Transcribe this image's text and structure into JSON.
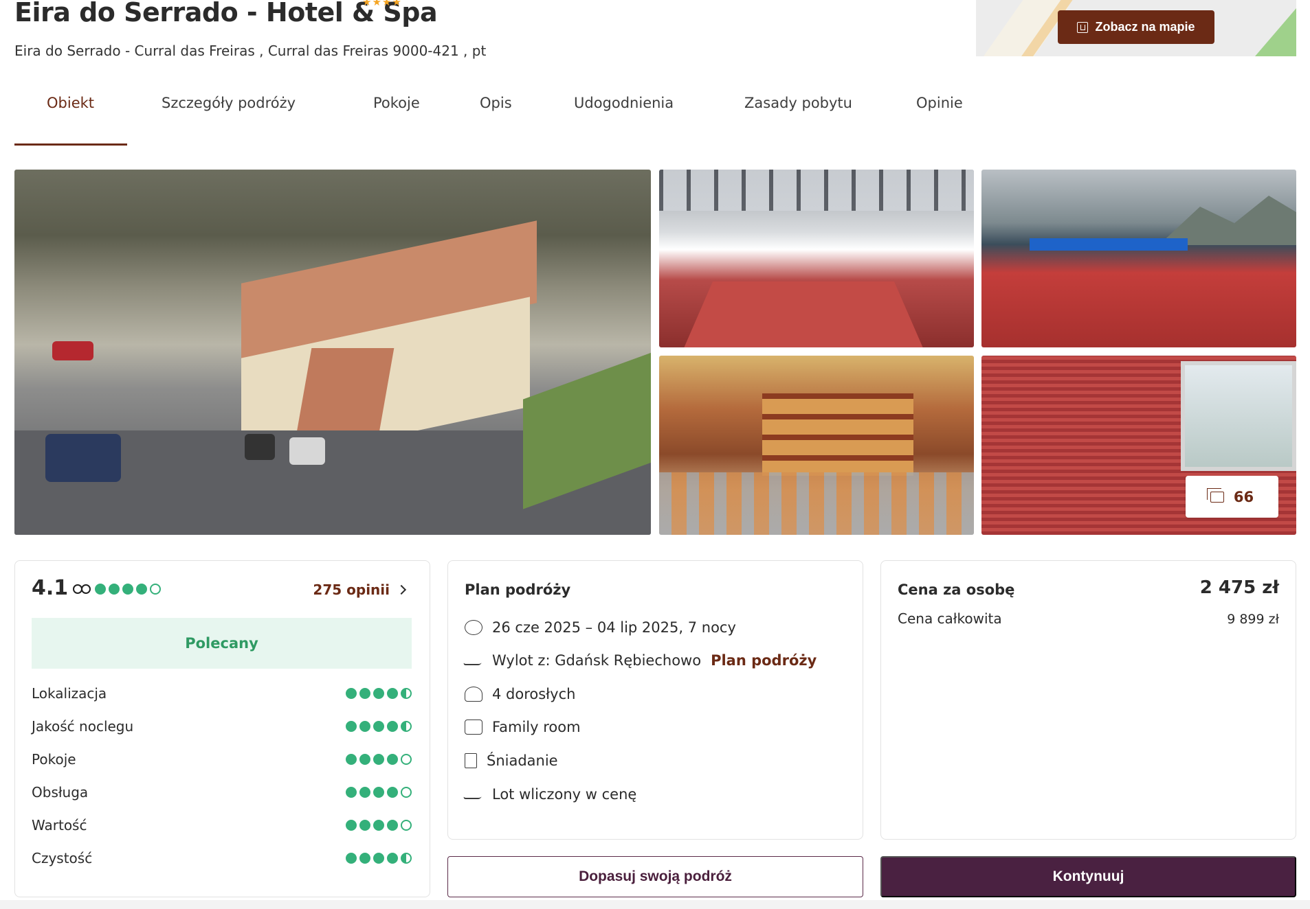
{
  "header": {
    "title": "Eira do Serrado - Hotel & Spa",
    "stars": "★★★★",
    "address": "Eira do Serrado - Curral das Freiras , Curral das Freiras 9000-421 , pt",
    "map_button": "Zobacz na mapie"
  },
  "tabs": [
    {
      "label": "Obiekt",
      "active": true
    },
    {
      "label": "Szczegóły podróży",
      "active": false
    },
    {
      "label": "Pokoje",
      "active": false
    },
    {
      "label": "Opis",
      "active": false
    },
    {
      "label": "Udogodnienia",
      "active": false
    },
    {
      "label": "Zasady pobytu",
      "active": false
    },
    {
      "label": "Opinie",
      "active": false
    }
  ],
  "gallery": {
    "photo_count": "66"
  },
  "reviews": {
    "score": "4.1",
    "rating_circles": 4,
    "count_link": "275 opinii",
    "badge": "Polecany",
    "categories": [
      {
        "label": "Lokalizacja",
        "rating": 4.5
      },
      {
        "label": "Jakość noclegu",
        "rating": 4.5
      },
      {
        "label": "Pokoje",
        "rating": 4
      },
      {
        "label": "Obsługa",
        "rating": 4
      },
      {
        "label": "Wartość",
        "rating": 4
      },
      {
        "label": "Czystość",
        "rating": 4.5
      }
    ]
  },
  "trip": {
    "title": "Plan podróży",
    "dates": "26 cze 2025 – 04 lip 2025, 7 nocy",
    "departure": "Wylot z: Gdańsk Rębiechowo",
    "departure_link": "Plan podróży",
    "guests": "4 dorosłych",
    "room": "Family room",
    "board": "Śniadanie",
    "flight": "Lot wliczony w cenę"
  },
  "price": {
    "per_person_label": "Cena za osobę",
    "per_person": "2 475 zł",
    "total_label": "Cena całkowita",
    "total": "9 899 zł"
  },
  "actions": {
    "customize": "Dopasuj swoją podróż",
    "continue": "Kontynuuj"
  },
  "colors": {
    "accent": "#6b2a15",
    "primary_button": "#4a2141",
    "rating_green": "#34b07a",
    "badge_bg": "#e7f6ef",
    "stars": "#f5a524"
  }
}
